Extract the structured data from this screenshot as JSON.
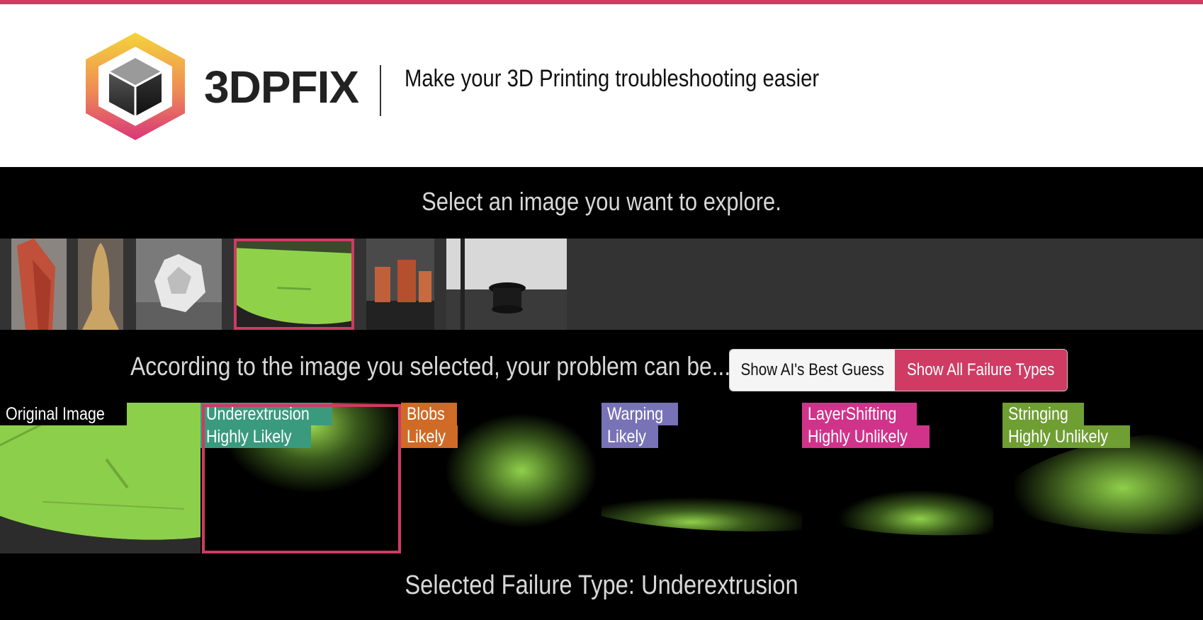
{
  "header": {
    "brand": "3DPFIX",
    "tagline": "Make your 3D Printing troubleshooting easier"
  },
  "gallery": {
    "prompt": "Select an image you want to explore.",
    "selected_index": 3
  },
  "analysis": {
    "prompt": "According to the image you selected, your problem can be...",
    "buttons": {
      "best_guess": "Show AI's Best Guess",
      "all_types": "Show All Failure Types"
    },
    "panels": [
      {
        "title": "Original Image",
        "likelihood": "",
        "color": "#000000"
      },
      {
        "title": "Underextrusion",
        "likelihood": "Highly Likely",
        "color": "#3a9a7e"
      },
      {
        "title": "Blobs",
        "likelihood": "Likely",
        "color": "#d06a27"
      },
      {
        "title": "Warping",
        "likelihood": "Likely",
        "color": "#7873b6"
      },
      {
        "title": "LayerShifting",
        "likelihood": "Highly Unlikely",
        "color": "#d1338b"
      },
      {
        "title": "Stringing",
        "likelihood": "Highly Unlikely",
        "color": "#6f9e33"
      }
    ],
    "selected_panel": 1
  },
  "footer": {
    "selected_type": "Selected Failure Type: Underextrusion"
  },
  "colors": {
    "accent": "#cf3b63",
    "background": "#000000",
    "strip": "#333333"
  }
}
